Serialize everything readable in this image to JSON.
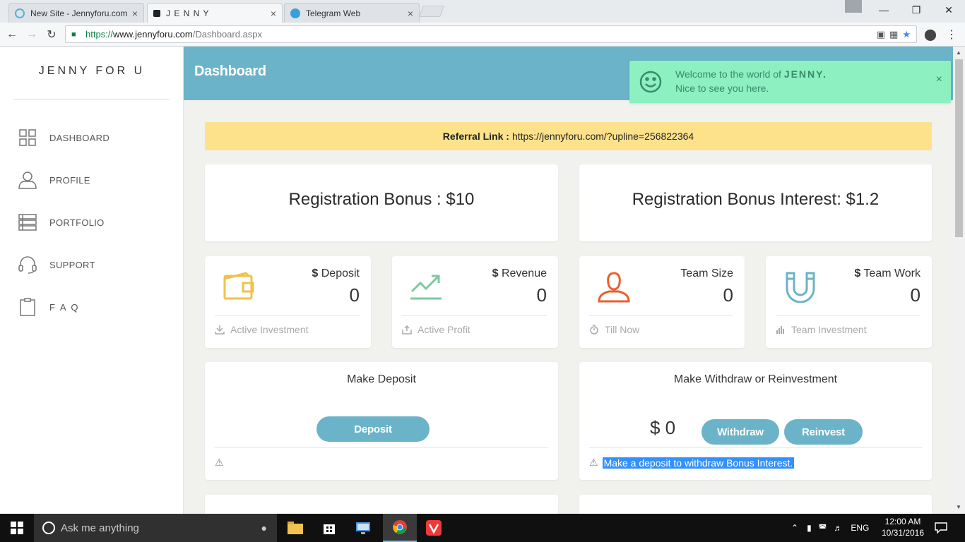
{
  "browser": {
    "tabs": [
      {
        "title": "New Site - Jennyforu.com",
        "close": "×"
      },
      {
        "title": "J E N N Y",
        "close": "×"
      },
      {
        "title": "Telegram Web",
        "close": "×"
      }
    ],
    "url": {
      "scheme": "https://",
      "host": "www.jennyforu.com",
      "path": "/Dashboard.aspx"
    },
    "window_controls": {
      "minimize": "—",
      "restore": "❐",
      "close": "✕"
    }
  },
  "sidebar": {
    "brand": "JENNY FOR U",
    "items": [
      {
        "label": "DASHBOARD",
        "icon": "grid-icon"
      },
      {
        "label": "PROFILE",
        "icon": "user-icon"
      },
      {
        "label": "PORTFOLIO",
        "icon": "list-icon"
      },
      {
        "label": "SUPPORT",
        "icon": "headset-icon"
      },
      {
        "label": "F A Q",
        "icon": "clipboard-icon"
      }
    ]
  },
  "header": {
    "title": "Dashboard"
  },
  "toast": {
    "line1_prefix": "Welcome to the world of ",
    "line1_brand": "JENNY.",
    "line2": "Nice to see you here.",
    "close": "×"
  },
  "referral": {
    "label": "Referral Link :",
    "link": "https://jennyforu.com/?upline=256822364"
  },
  "bonus": {
    "registration": "Registration Bonus : $10",
    "interest": "Registration Bonus Interest: $1.2"
  },
  "stats": [
    {
      "currency": "$",
      "label": " Deposit",
      "value": "0",
      "footer": "Active Investment",
      "color": "#f0c14b"
    },
    {
      "currency": "$",
      "label": " Revenue",
      "value": "0",
      "footer": "Active Profit",
      "color": "#7cc9a0"
    },
    {
      "currency": "",
      "label": "Team Size",
      "value": "0",
      "footer": "Till Now",
      "color": "#e8602c"
    },
    {
      "currency": "$",
      "label": " Team Work",
      "value": "0",
      "footer": "Team Investment",
      "color": "#6bb3c8"
    }
  ],
  "deposit_card": {
    "title": "Make Deposit",
    "button": "Deposit"
  },
  "withdraw_card": {
    "title": "Make Withdraw or Reinvestment",
    "amount": "$ 0",
    "withdraw_button": "Withdraw",
    "reinvest_button": "Reinvest",
    "notice": "Make a deposit to withdraw Bonus Interest."
  },
  "taskbar": {
    "search_placeholder": "Ask me anything",
    "language": "ENG",
    "time": "12:00 AM",
    "date": "10/31/2016"
  },
  "colors": {
    "accent": "#6bb3c8",
    "toast": "#8cf0c0",
    "referral": "#fde28b"
  }
}
